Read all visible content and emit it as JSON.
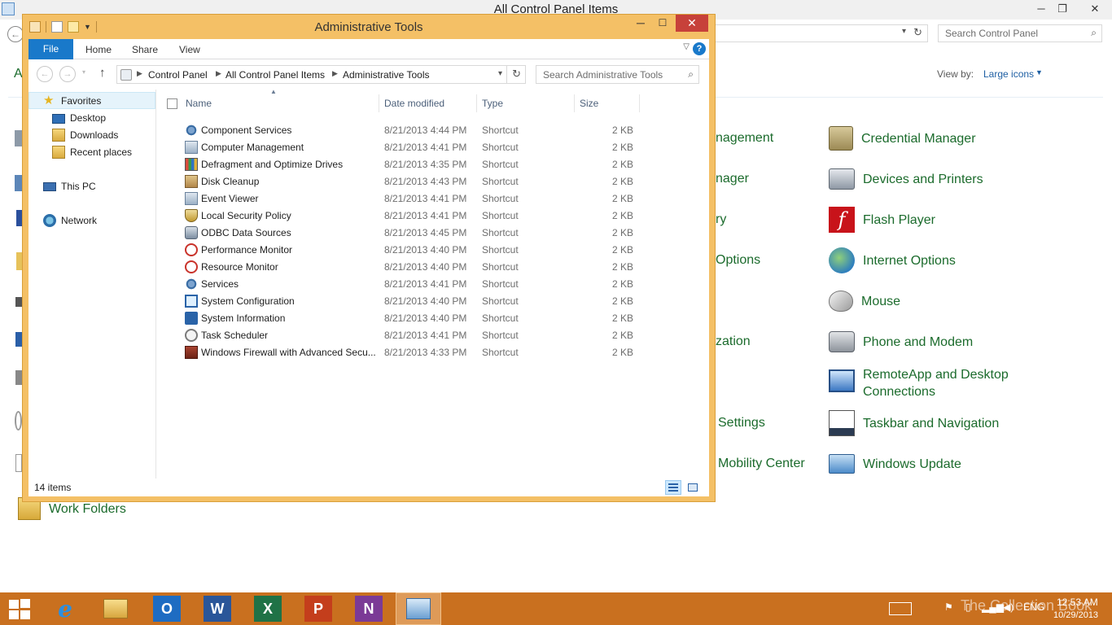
{
  "background_window": {
    "title": "All Control Panel Items",
    "controls": {
      "minimize": "─",
      "restore": "❐",
      "close": "✕"
    },
    "back_icon": "←",
    "search": {
      "placeholder": "Search Control Panel"
    },
    "view_by": {
      "label": "View by:",
      "value": "Large icons"
    },
    "left_fragments": [
      "A"
    ],
    "middle_fragments": [
      "nagement",
      "nager",
      "ry",
      "Options",
      "zation",
      "Settings",
      "Mobility Center"
    ],
    "right_items": [
      {
        "label": "Credential Manager",
        "icon": "credential-vault-icon"
      },
      {
        "label": "Devices and Printers",
        "icon": "printer-icon"
      },
      {
        "label": "Flash Player",
        "icon": "flash-icon"
      },
      {
        "label": "Internet Options",
        "icon": "globe-icon"
      },
      {
        "label": "Mouse",
        "icon": "mouse-icon"
      },
      {
        "label": "Phone and Modem",
        "icon": "phone-icon"
      },
      {
        "label": "RemoteApp and Desktop Connections",
        "icon": "remote-desktop-icon"
      },
      {
        "label": "Taskbar and Navigation",
        "icon": "taskbar-icon"
      },
      {
        "label": "Windows Update",
        "icon": "update-icon"
      }
    ],
    "bottom_item": {
      "label": "Work Folders",
      "icon": "work-folders-icon"
    }
  },
  "explorer": {
    "title": "Administrative Tools",
    "controls": {
      "minimize": "─",
      "maximize": "☐",
      "close": "✕"
    },
    "ribbon_tabs": {
      "file": "File",
      "home": "Home",
      "share": "Share",
      "view": "View"
    },
    "help": "?",
    "nav": {
      "back": "←",
      "forward": "→",
      "up": "↑",
      "recent": "▾"
    },
    "breadcrumb": [
      "Control Panel",
      "All Control Panel Items",
      "Administrative Tools"
    ],
    "search": {
      "placeholder": "Search Administrative Tools"
    },
    "nav_pane": {
      "favorites": "Favorites",
      "desktop": "Desktop",
      "downloads": "Downloads",
      "recent": "Recent places",
      "this_pc": "This PC",
      "network": "Network"
    },
    "columns": {
      "name": "Name",
      "date": "Date modified",
      "type": "Type",
      "size": "Size"
    },
    "files": [
      {
        "name": "Component Services",
        "date": "8/21/2013 4:44 PM",
        "type": "Shortcut",
        "size": "2 KB",
        "icon": "component-services-icon"
      },
      {
        "name": "Computer Management",
        "date": "8/21/2013 4:41 PM",
        "type": "Shortcut",
        "size": "2 KB",
        "icon": "computer-management-icon"
      },
      {
        "name": "Defragment and Optimize Drives",
        "date": "8/21/2013 4:35 PM",
        "type": "Shortcut",
        "size": "2 KB",
        "icon": "defragment-icon"
      },
      {
        "name": "Disk Cleanup",
        "date": "8/21/2013 4:43 PM",
        "type": "Shortcut",
        "size": "2 KB",
        "icon": "disk-cleanup-icon"
      },
      {
        "name": "Event Viewer",
        "date": "8/21/2013 4:41 PM",
        "type": "Shortcut",
        "size": "2 KB",
        "icon": "event-viewer-icon"
      },
      {
        "name": "Local Security Policy",
        "date": "8/21/2013 4:41 PM",
        "type": "Shortcut",
        "size": "2 KB",
        "icon": "security-policy-icon"
      },
      {
        "name": "ODBC Data Sources",
        "date": "8/21/2013 4:45 PM",
        "type": "Shortcut",
        "size": "2 KB",
        "icon": "odbc-icon"
      },
      {
        "name": "Performance Monitor",
        "date": "8/21/2013 4:40 PM",
        "type": "Shortcut",
        "size": "2 KB",
        "icon": "performance-monitor-icon"
      },
      {
        "name": "Resource Monitor",
        "date": "8/21/2013 4:40 PM",
        "type": "Shortcut",
        "size": "2 KB",
        "icon": "resource-monitor-icon"
      },
      {
        "name": "Services",
        "date": "8/21/2013 4:41 PM",
        "type": "Shortcut",
        "size": "2 KB",
        "icon": "services-icon"
      },
      {
        "name": "System Configuration",
        "date": "8/21/2013 4:40 PM",
        "type": "Shortcut",
        "size": "2 KB",
        "icon": "system-configuration-icon"
      },
      {
        "name": "System Information",
        "date": "8/21/2013 4:40 PM",
        "type": "Shortcut",
        "size": "2 KB",
        "icon": "system-information-icon"
      },
      {
        "name": "Task Scheduler",
        "date": "8/21/2013 4:41 PM",
        "type": "Shortcut",
        "size": "2 KB",
        "icon": "task-scheduler-icon"
      },
      {
        "name": "Windows Firewall with Advanced Secu...",
        "date": "8/21/2013 4:33 PM",
        "type": "Shortcut",
        "size": "2 KB",
        "icon": "firewall-icon"
      }
    ],
    "status": {
      "count": "14 items"
    }
  },
  "taskbar": {
    "apps": {
      "ie": "e",
      "outlook": "O",
      "word": "W",
      "excel": "X",
      "powerpoint": "P",
      "onenote": "N"
    },
    "tray": {
      "language": "ENG"
    },
    "clock": {
      "time": "12:53 AM",
      "date": "10/29/2013"
    }
  },
  "watermark": "The Collection Book"
}
